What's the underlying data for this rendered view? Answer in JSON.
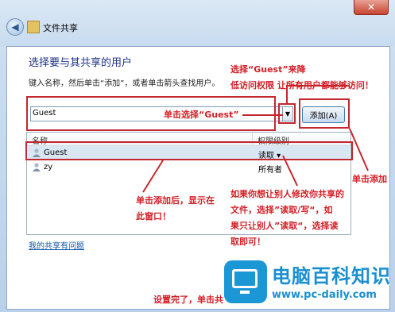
{
  "window": {
    "title": "文件共享",
    "back_icon": "back-arrow-icon",
    "close_symbol": "✕"
  },
  "dialog": {
    "heading": "选择要与其共享的用户",
    "hint": "键入名称，然后单击“添加”，或者单击箭头查找用户。",
    "combo_value": "Guest",
    "dropdown_symbol": "▼",
    "add_button": "添加(A)",
    "columns": {
      "name": "名称",
      "permission": "权限级别"
    },
    "rows": [
      {
        "name": "Guest",
        "permission": "读取 ▾",
        "selected": true
      },
      {
        "name": "zy",
        "permission": "所有者",
        "selected": false
      }
    ],
    "help_link": "我的共享有问题"
  },
  "annotations": {
    "select_guest": "单击选择“Guest”",
    "guest_note_line1": "选择“Guest”来降",
    "guest_note_line2": "低访问权限 让所有用户都能够访问！",
    "click_add": "单击添加",
    "after_add_line1": "单击添加后，显示在",
    "after_add_line2": "此窗口！",
    "perm_line1": "如果你想让别人修改你共享的",
    "perm_line2": "文件，选择”读取/写“，如",
    "perm_line3": "果只让别人”读取“，选择读",
    "perm_line4": "取即可！",
    "done": "设置完了，单击共"
  },
  "watermark": {
    "brand": "电脑百科知识",
    "url": "www.pc-daily.com"
  },
  "colors": {
    "annotation": "#d21f26",
    "heading": "#1e3287",
    "selection": "#d9e6f4",
    "brand": "#1a8fd0"
  }
}
